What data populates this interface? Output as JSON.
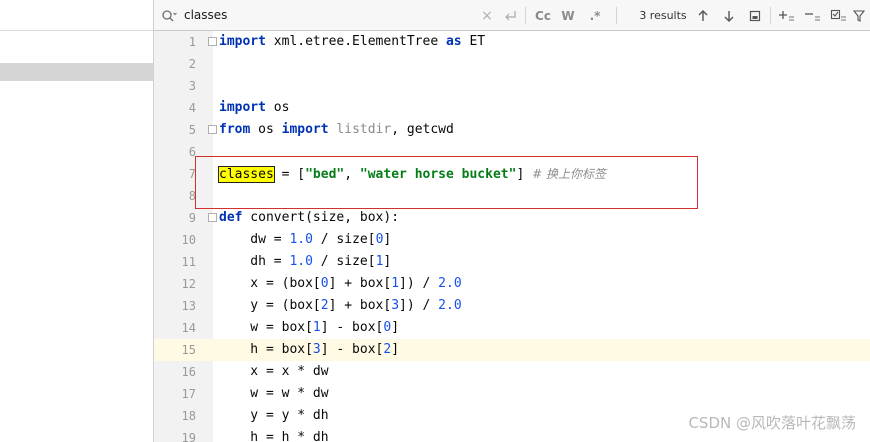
{
  "find_bar": {
    "query": "classes",
    "match_case_label": "Cc",
    "words_label": "W",
    "regex_label": ".*",
    "results_label": "3 results"
  },
  "editor": {
    "lines": [
      {
        "n": "1"
      },
      {
        "n": "2"
      },
      {
        "n": "3"
      },
      {
        "n": "4"
      },
      {
        "n": "5"
      },
      {
        "n": "6"
      },
      {
        "n": "7"
      },
      {
        "n": "8"
      },
      {
        "n": "9"
      },
      {
        "n": "10"
      },
      {
        "n": "11"
      },
      {
        "n": "12"
      },
      {
        "n": "13"
      },
      {
        "n": "14"
      },
      {
        "n": "15"
      },
      {
        "n": "16"
      },
      {
        "n": "17"
      },
      {
        "n": "18"
      },
      {
        "n": "19"
      }
    ],
    "tokens": {
      "l1": [
        "import",
        " xml.etree.ElementTree ",
        "as",
        " ET"
      ],
      "l4": [
        "import",
        " os"
      ],
      "l5": [
        "from",
        " os ",
        "import",
        " listdir",
        ", getcwd"
      ],
      "l7": [
        "classes",
        " = [",
        "\"bed\"",
        ", ",
        "\"water horse bucket\"",
        "] ",
        "# 换上你标签"
      ],
      "l9": [
        "def",
        " convert(size, box):"
      ],
      "l10": [
        "    dw = ",
        "1.0",
        " / size[",
        "0",
        "]"
      ],
      "l11": [
        "    dh = ",
        "1.0",
        " / size[",
        "1",
        "]"
      ],
      "l12": [
        "    x = (box[",
        "0",
        "] + box[",
        "1",
        "]) / ",
        "2.0"
      ],
      "l13": [
        "    y = (box[",
        "2",
        "] + box[",
        "3",
        "]) / ",
        "2.0"
      ],
      "l14": [
        "    w = box[",
        "1",
        "] - box[",
        "0",
        "]"
      ],
      "l15": [
        "    h = box[",
        "3",
        "] - box[",
        "2",
        "]"
      ],
      "l16": [
        "    x = x * dw"
      ],
      "l17": [
        "    w = w * dw"
      ],
      "l18": [
        "    y = y * dh"
      ],
      "l19": [
        "    h = h * dh"
      ]
    }
  },
  "watermark": "CSDN @风吹落叶花飘荡"
}
